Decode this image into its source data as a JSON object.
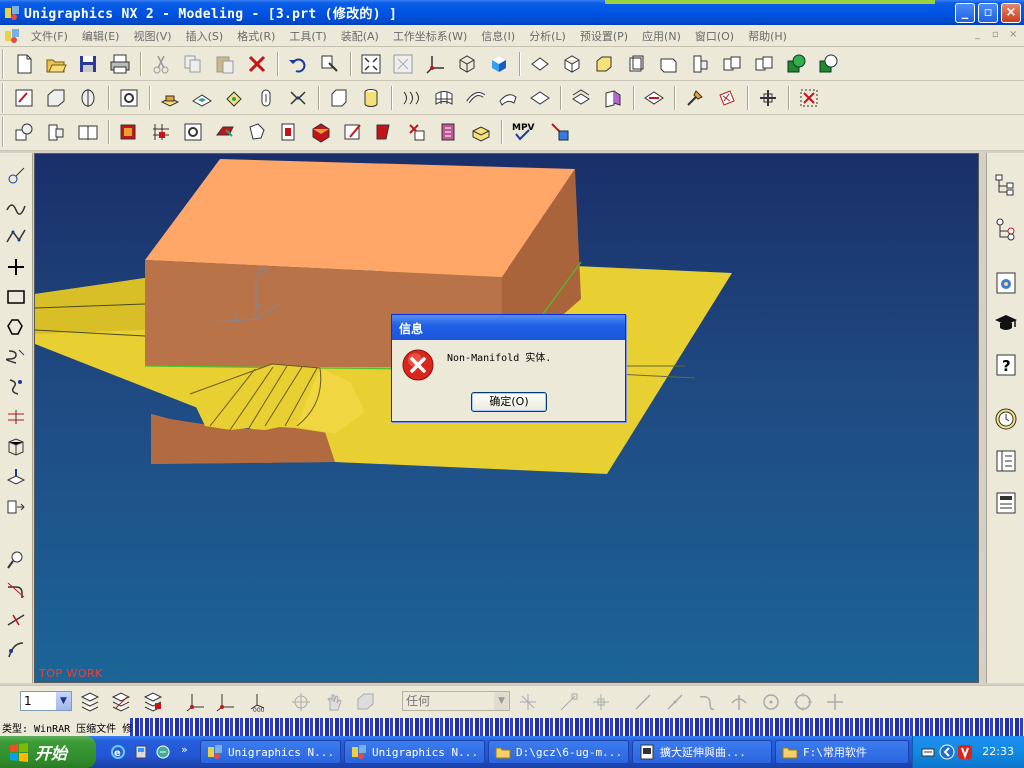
{
  "window": {
    "title": "Unigraphics NX 2 - Modeling - [3.prt  (修改的) ]",
    "minimize": "_",
    "restore": "▫",
    "close": "×"
  },
  "menu": {
    "items": [
      "文件(F)",
      "编辑(E)",
      "视图(V)",
      "插入(S)",
      "格式(R)",
      "工具(T)",
      "装配(A)",
      "工作坐标系(W)",
      "信息(I)",
      "分析(L)",
      "预设置(P)",
      "应用(N)",
      "窗口(O)",
      "帮助(H)"
    ]
  },
  "viewport": {
    "wcs_label": "ZC",
    "watermark": "TOP WORK"
  },
  "dialog": {
    "title": "信息",
    "message": "Non-Manifold 实体.",
    "ok_button": "确定(O)",
    "icon": "error-icon"
  },
  "bottombar": {
    "layer_value": "1",
    "filter_value": "任何"
  },
  "status": {
    "text": "类型: WinRAR 压缩文件 修"
  },
  "taskbar": {
    "start_label": "开始",
    "tasks": [
      {
        "label": "Unigraphics N...",
        "icon": "ug-icon"
      },
      {
        "label": "Unigraphics N...",
        "icon": "ug-icon"
      },
      {
        "label": "D:\\gcz\\6-ug-m...",
        "icon": "folder-icon"
      },
      {
        "label": "擴大延伸與曲...",
        "icon": "doc-icon"
      },
      {
        "label": "F:\\常用软件",
        "icon": "folder-icon"
      }
    ],
    "clock": "22:33"
  },
  "colors": {
    "titlebar": "#0054e3",
    "viewport_top": "#1a2f69",
    "viewport_bottom": "#1b6597",
    "solid_face": "#ffa768",
    "solid_side": "#b87045",
    "sheet": "#e8cf32",
    "error": "#d9261c"
  }
}
